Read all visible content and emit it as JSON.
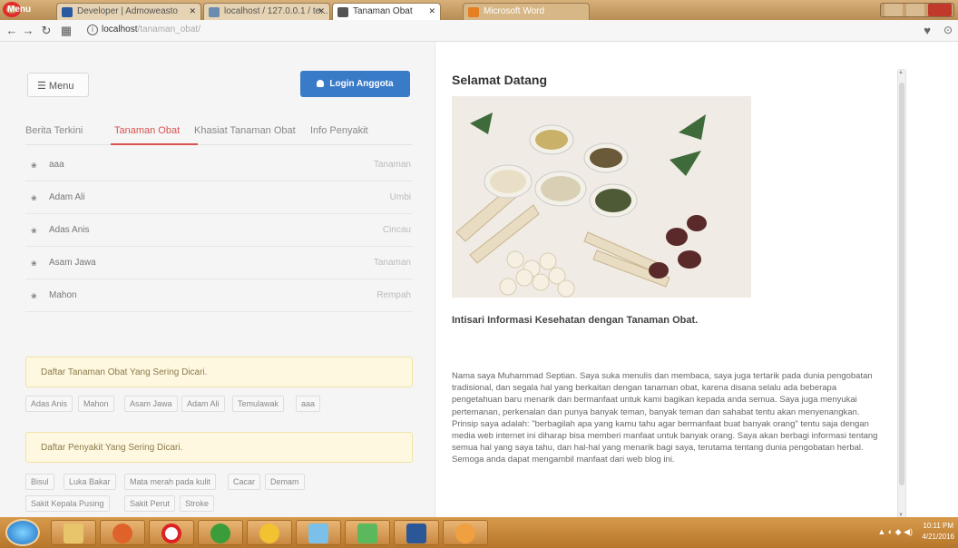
{
  "browser": {
    "menu_label": "Menu",
    "tabs": [
      {
        "title": "Developer | Admoweasto"
      },
      {
        "title": "localhost / 127.0.0.1 / te..."
      },
      {
        "title": "Tanaman Obat"
      },
      {
        "title": "Microsoft Word"
      }
    ],
    "url_host": "localhost",
    "url_path": "/tanaman_obat/"
  },
  "sidebar": {
    "menu_button": "Menu",
    "login_button": "Login Anggota",
    "tabs": [
      "Berita Terkini",
      "Tanaman Obat",
      "Khasiat Tanaman Obat",
      "Info Penyakit"
    ],
    "active_tab": "Tanaman Obat",
    "items": [
      {
        "name": "aaa",
        "category": "Tanaman"
      },
      {
        "name": "Adam Ali",
        "category": "Umbi"
      },
      {
        "name": "Adas Anis",
        "category": "Cincau"
      },
      {
        "name": "Asam Jawa",
        "category": "Tanaman"
      },
      {
        "name": "Mahon",
        "category": "Rempah"
      }
    ],
    "herbs_notice": "Daftar Tanaman Obat Yang Sering Dicari.",
    "herbs_tags": [
      "Adas Anis",
      "Mahon",
      "Asam Jawa",
      "Adam Ali",
      "Temulawak",
      "aaa"
    ],
    "disease_notice": "Daftar Penyakit Yang Sering Dicari.",
    "disease_tags": [
      "Bisul",
      "Luka Bakar",
      "Mata merah pada kulit",
      "Cacar",
      "Demam",
      "Sakit Kepala Pusing",
      "Sakit Perut",
      "Stroke"
    ]
  },
  "main": {
    "welcome": "Selamat Datang",
    "subtitle": "Intisari Informasi Kesehatan dengan Tanaman Obat.",
    "paragraph": "Nama saya Muhammad Septian. Saya suka menulis dan membaca, saya juga tertarik pada dunia pengobatan tradisional, dan segala hal yang berkaitan dengan tanaman obat, karena disana selalu ada beberapa pengetahuan baru menarik dan bermanfaat untuk kami bagikan kepada anda semua. Saya juga menyukai pertemanan, perkenalan dan punya banyak teman, banyak teman dan sahabat tentu akan menyenangkan. Prinsip saya adalah: \"berbagilah apa yang kamu tahu agar bermanfaat buat banyak orang\" tentu saja dengan media web internet ini diharap bisa memberi manfaat untuk banyak orang. Saya akan berbagi informasi tentang semua hal yang saya tahu, dan hal-hal yang menarik bagi saya, terutama tentang dunia pengobatan herbal. Semoga anda dapat mengambil manfaat dari web blog ini."
  },
  "taskbar": {
    "time": "10:11 PM",
    "date": "4/21/2016"
  },
  "colors": {
    "accent_red": "#d9534f",
    "login_blue": "#3a7bc8",
    "notice_bg": "#fff8e1"
  }
}
